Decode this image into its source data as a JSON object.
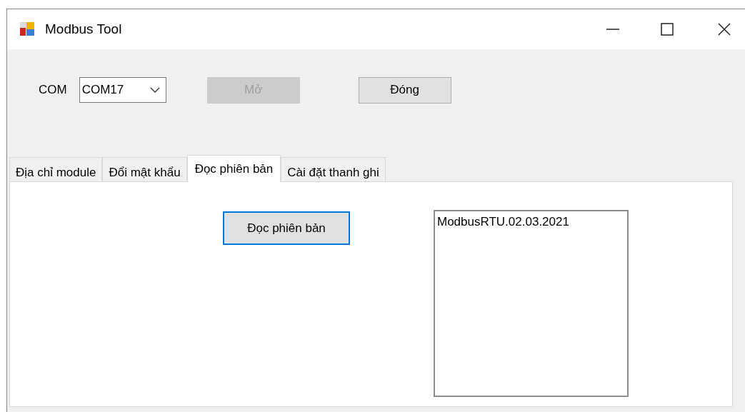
{
  "window": {
    "title": "Modbus Tool"
  },
  "port": {
    "label": "COM",
    "value": "COM17"
  },
  "buttons": [
    {
      "label": "Mở",
      "disabled": true
    },
    {
      "label": "Đóng",
      "disabled": false
    }
  ],
  "tabs": [
    {
      "label": "Địa chỉ module",
      "selected": false
    },
    {
      "label": "Đổi mật khẩu",
      "selected": false
    },
    {
      "label": "Đọc phiên bản",
      "selected": true
    },
    {
      "label": "Cài đặt thanh ghi",
      "selected": false
    }
  ],
  "read_button": {
    "label": "Đọc phiên bản",
    "focused": true
  },
  "output": {
    "value": "ModbusRTU.02.03.2021"
  }
}
